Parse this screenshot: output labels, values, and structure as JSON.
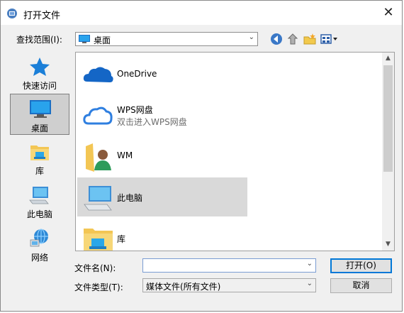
{
  "window": {
    "title": "打开文件"
  },
  "lookin": {
    "label": "查找范围(I):",
    "value": "桌面",
    "icons": [
      "back-icon",
      "up-folder-icon",
      "new-folder-icon",
      "view-menu-icon"
    ]
  },
  "places": [
    {
      "label": "快速访问",
      "icon": "star-icon",
      "selected": false
    },
    {
      "label": "桌面",
      "icon": "monitor-icon",
      "selected": true
    },
    {
      "label": "库",
      "icon": "library-icon",
      "selected": false
    },
    {
      "label": "此电脑",
      "icon": "computer-icon",
      "selected": false
    },
    {
      "label": "网络",
      "icon": "network-icon",
      "selected": false
    }
  ],
  "files": [
    {
      "name": "OneDrive",
      "subtitle": "",
      "icon": "onedrive-cloud-icon"
    },
    {
      "name": "WPS网盘",
      "subtitle": "双击进入WPS网盘",
      "icon": "wps-cloud-icon"
    },
    {
      "name": "WM",
      "subtitle": "",
      "icon": "user-folder-icon"
    },
    {
      "name": "此电脑",
      "subtitle": "",
      "icon": "computer-icon",
      "highlighted": true
    },
    {
      "name": "库",
      "subtitle": "",
      "icon": "library-icon"
    }
  ],
  "filename": {
    "label": "文件名(N):",
    "value": ""
  },
  "filetype": {
    "label": "文件类型(T):",
    "value": "媒体文件(所有文件)"
  },
  "buttons": {
    "open": "打开(O)",
    "cancel": "取消"
  },
  "colors": {
    "accent": "#0078d7",
    "highlight": "#d9d9d9"
  }
}
